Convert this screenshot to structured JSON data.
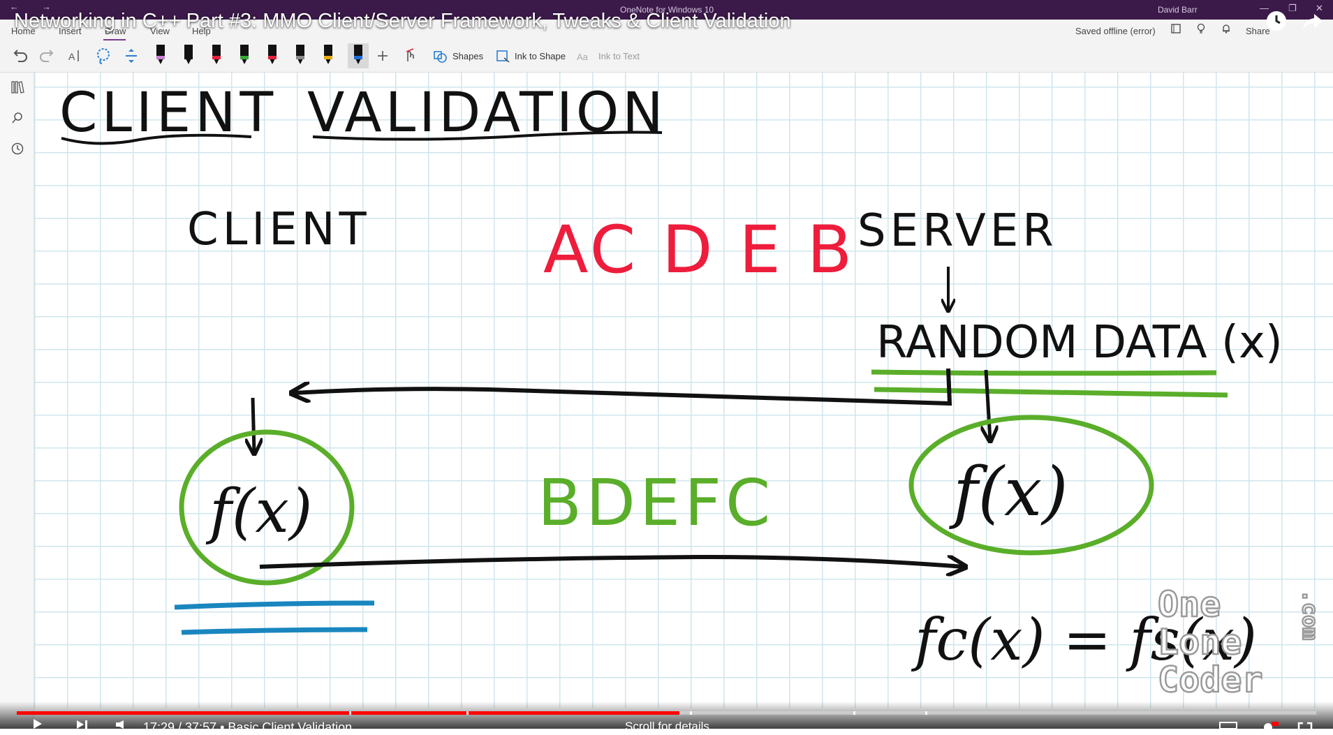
{
  "window": {
    "app_title": "OneNote for Windows 10",
    "user": "David Barr"
  },
  "video": {
    "title": "Networking in C++ Part #3: MMO Client/Server Framework, Tweaks & Client Validation",
    "progress_fraction": 0.51,
    "time_display": "17:29 / 37:57 • Basic Client Validation",
    "scroll_hint": "Scroll for details"
  },
  "menu": {
    "tabs": [
      "Home",
      "Insert",
      "Draw",
      "View",
      "Help"
    ],
    "active_tab": "Draw",
    "status": "Saved offline (error)",
    "share": "Share"
  },
  "toolbar": {
    "shapes": "Shapes",
    "ink_to_shape": "Ink to Shape",
    "ink_to_text": "Ink to Text",
    "pens": [
      {
        "color": "#111111",
        "tip": "#c77dd1"
      },
      {
        "color": "#111111",
        "tip": "#111111"
      },
      {
        "color": "#111111",
        "tip": "#e3223b"
      },
      {
        "color": "#111111",
        "tip": "#3aa63a"
      },
      {
        "color": "#111111",
        "tip": "#e3223b"
      },
      {
        "color": "#111111",
        "tip": "#888888"
      },
      {
        "color": "#111111",
        "tip": "#e8a90c"
      },
      {
        "color": "#111111",
        "tip": "#1f6fd6"
      }
    ]
  },
  "canvas": {
    "heading_client": "CLIENT",
    "heading_validation": "VALIDATION",
    "label_client": "CLIENT",
    "label_server": "SERVER",
    "red_sequence": "AC D E B",
    "green_sequence": "BDEFC",
    "random_data": "RANDOM DATA (x)",
    "client_func": "f(x)",
    "server_func": "f(x)",
    "equation": "fc(x) = fs(x)"
  },
  "watermark": {
    "line1": "One",
    "line2": "Lone",
    "line3": "Coder",
    "suffix": ".com"
  },
  "colors": {
    "titlebar": "#3b1a4a",
    "red_ink": "#ee1d3c",
    "green_ink": "#5aae2a",
    "blue_ink": "#1a86bf",
    "grid": "#cfe6ec"
  }
}
